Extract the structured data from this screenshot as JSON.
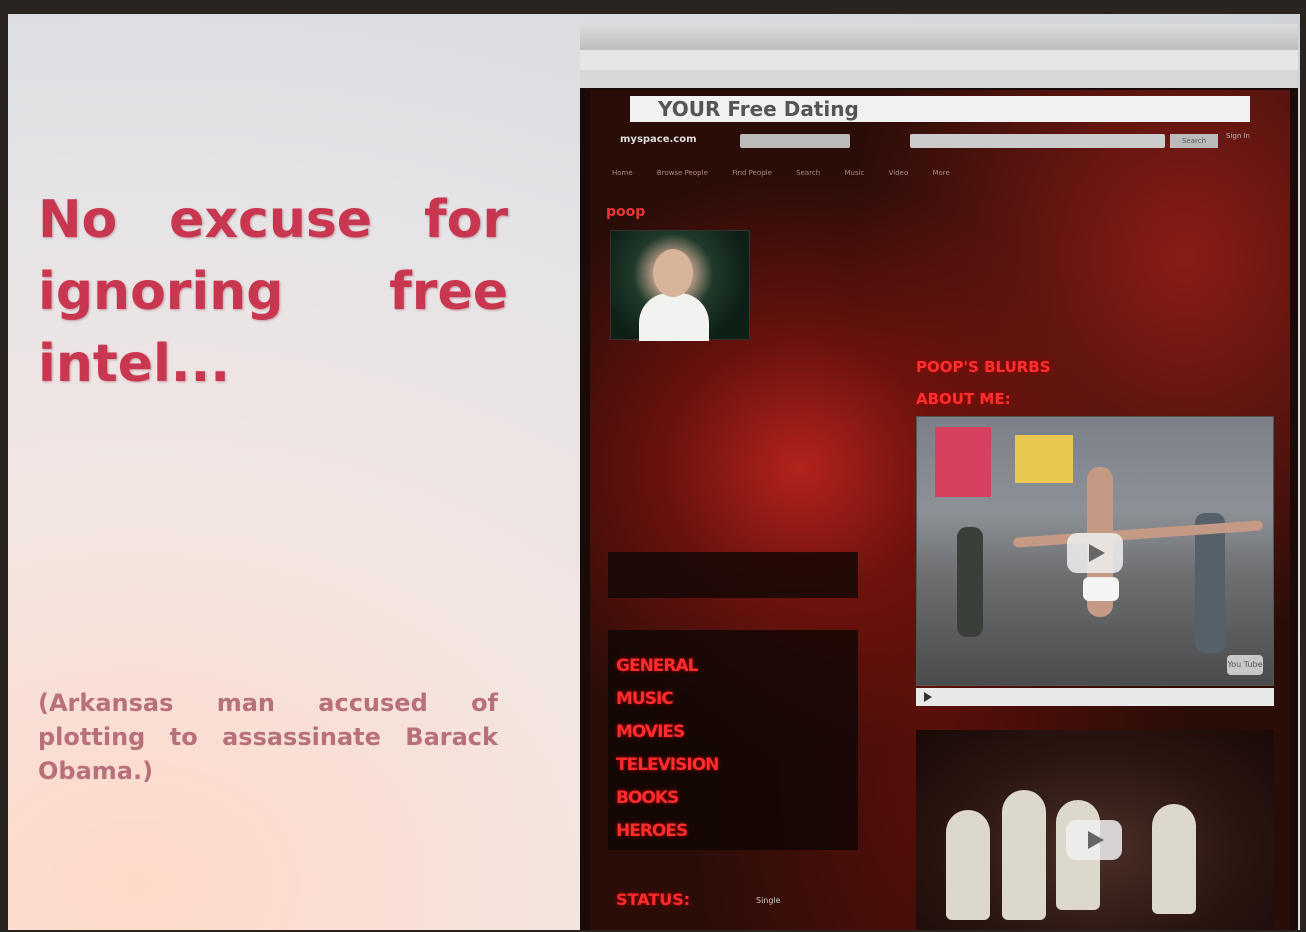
{
  "slide": {
    "headline": "No excuse for ignoring free intel...",
    "caption": "(Arkansas man accused of plotting to assassinate Barack Obama.)"
  },
  "screenshot": {
    "ad_banner": "YOUR Free Dating",
    "header": {
      "logo": "myspace.com",
      "search_button": "Search",
      "sign_in": "Sign In"
    },
    "nav": [
      "Home",
      "Browse People",
      "Find People",
      "Search",
      "Music",
      "Video",
      "More"
    ],
    "profile": {
      "name": "poop",
      "blurbs_title": "POOP'S BLURBS",
      "about_title": "ABOUT ME:",
      "status_label": "STATUS:",
      "status_value": "Single"
    },
    "interests": [
      "GENERAL",
      "MUSIC",
      "MOVIES",
      "TELEVISION",
      "BOOKS",
      "HEROES"
    ],
    "video": {
      "badge": "You Tube"
    },
    "colors": {
      "headline": "#c9364f",
      "caption": "#b8707a",
      "profile_accent": "#ff2d2d"
    }
  }
}
